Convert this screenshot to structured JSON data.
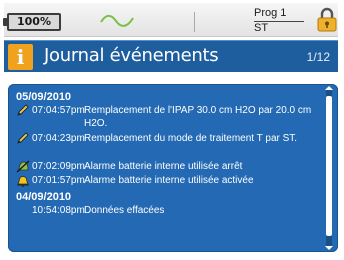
{
  "status_bar": {
    "battery_label": "100%",
    "program_name": "Prog 1",
    "program_mode": "ST",
    "icons": [
      "battery-icon",
      "sine-wave-icon",
      "lock-icon"
    ]
  },
  "title_bar": {
    "title": "Journal événements",
    "page_counter": "1/12",
    "icon": "info-icon"
  },
  "journal": {
    "days": [
      {
        "date": "05/09/2010",
        "entries": [
          {
            "icon": "edit-pencil-icon",
            "time": "07:04:57pm",
            "message": "Remplacement de l'IPAP 30.0 cm H2O par 20.0 cm H2O."
          },
          {
            "icon": "edit-pencil-icon",
            "time": "07:04:23pm",
            "message": "Remplacement du mode de traitement T par ST."
          },
          {
            "icon": "alarm-off-icon",
            "time": "07:02:09pm",
            "message": "Alarme batterie interne utilisée arrêt"
          },
          {
            "icon": "alarm-bell-icon",
            "time": "07:01:57pm",
            "message": "Alarme batterie interne utilisée activée"
          }
        ]
      },
      {
        "date": "04/09/2010",
        "entries": [
          {
            "icon": "",
            "time": "10:54:08pm",
            "message": "Données effacées"
          }
        ]
      }
    ]
  },
  "colors": {
    "title_bar_bg": "#1f5e9e",
    "panel_bg": "#2369b3",
    "info_icon_bg": "#f0a21f",
    "lock_icon": "#f0b12a",
    "wave_icon": "#7ac043"
  }
}
